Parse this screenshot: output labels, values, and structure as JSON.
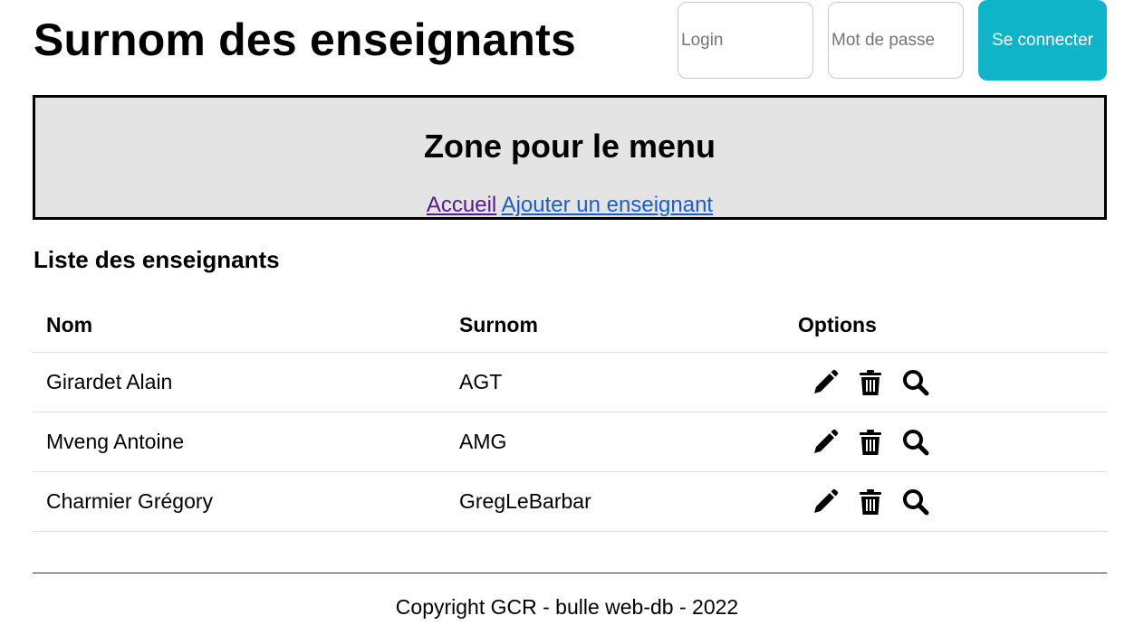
{
  "header": {
    "title": "Surnom des enseignants",
    "login_placeholder": "Login",
    "password_placeholder": "Mot de passe",
    "connect_label": "Se connecter",
    "accent_color": "#0fb4c8"
  },
  "menu": {
    "title": "Zone pour le menu",
    "links": [
      {
        "label": "Accueil",
        "visited": true
      },
      {
        "label": "Ajouter un enseignant",
        "visited": false
      }
    ]
  },
  "list": {
    "title": "Liste des enseignants",
    "columns": [
      "Nom",
      "Surnom",
      "Options"
    ],
    "rows": [
      {
        "nom": "Girardet Alain",
        "surnom": "AGT"
      },
      {
        "nom": "Mveng Antoine",
        "surnom": "AMG"
      },
      {
        "nom": "Charmier Grégory",
        "surnom": "GregLeBarbar"
      }
    ],
    "row_icons": [
      "pencil-icon",
      "trash-icon",
      "search-icon"
    ]
  },
  "footer": {
    "text": "Copyright GCR - bulle web-db - 2022"
  }
}
